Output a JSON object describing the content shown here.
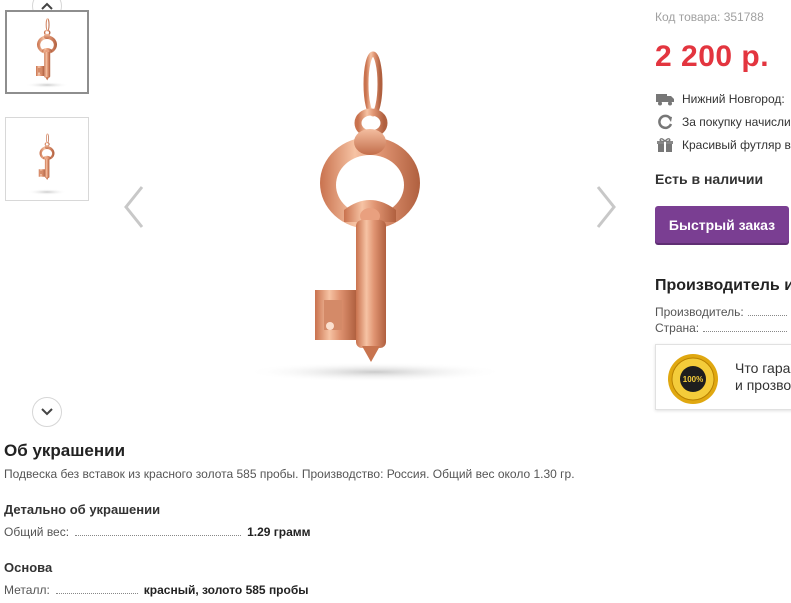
{
  "product": {
    "code_text": "Код товара: 351788",
    "price": "2 200 р.",
    "features": [
      {
        "icon": "truck-icon",
        "text": "Нижний Новгород:"
      },
      {
        "icon": "refresh-icon",
        "text": "За покупку начисли"
      },
      {
        "icon": "gift-icon",
        "text": "Красивый футляр в"
      }
    ],
    "stock_status": "Есть в наличии",
    "quick_order_label": "Быстрый заказ"
  },
  "manufacturer": {
    "title": "Производитель и",
    "rows": [
      {
        "label": "Производитель:"
      },
      {
        "label": "Страна:"
      }
    ],
    "guarantee_badge_text": "100%",
    "guarantee_lines": [
      "Что гара",
      "и прозво"
    ]
  },
  "gallery": {
    "thumbnails": [
      "thumb-key-front",
      "thumb-key-side"
    ],
    "active_index": 0,
    "metal_color": "#e3a07f"
  },
  "about": {
    "title": "Об украшении",
    "description": "Подвеска без вставок из красного золота 585 пробы. Производство: Россия. Общий вес около 1.30 гр.",
    "details_title": "Детально об украшении",
    "weight_label": "Общий вес:",
    "weight_value": "1.29 грамм",
    "base_title": "Основа",
    "metal_label": "Металл:",
    "metal_value": "красный, золото 585 пробы"
  },
  "colors": {
    "price": "#e3353f",
    "button": "#7a3e92"
  }
}
